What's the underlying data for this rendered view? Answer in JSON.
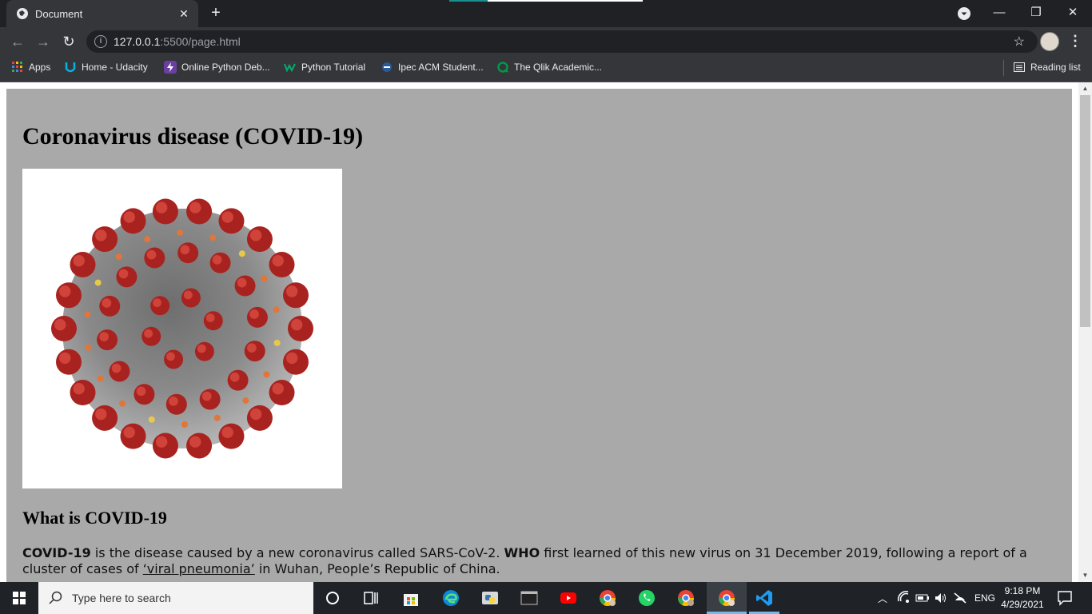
{
  "browser": {
    "tab_title": "Document",
    "url_host": "127.0.0.1",
    "url_rest": ":5500/page.html",
    "bookmarks": [
      {
        "label": "Apps",
        "icon": "apps-grid-icon"
      },
      {
        "label": "Home - Udacity",
        "icon": "udacity-icon"
      },
      {
        "label": "Online Python Deb...",
        "icon": "lightning-icon"
      },
      {
        "label": "Python Tutorial",
        "icon": "w3-icon"
      },
      {
        "label": "Ipec ACM Student...",
        "icon": "acm-icon"
      },
      {
        "label": "The Qlik Academic...",
        "icon": "qlik-icon"
      }
    ],
    "reading_list": "Reading list"
  },
  "page": {
    "title": "Coronavirus disease (COVID-19)",
    "section_heading": "What is COVID-19",
    "para_bold1": "COVID-19",
    "para_text1": " is the disease caused by a new coronavirus called SARS-CoV-2. ",
    "para_bold2": "WHO",
    "para_text2": " first learned of this new virus on 31 December 2019, following a report of a cluster of cases of ",
    "para_link": "‘viral pneumonia’",
    "para_text3": " in Wuhan, People’s Republic of China."
  },
  "taskbar": {
    "search_placeholder": "Type here to search",
    "language": "ENG",
    "time": "9:18 PM",
    "date": "4/29/2021"
  },
  "colors": {
    "page_bg": "#a9a9a9",
    "chrome_dark": "#202124",
    "chrome_toolbar": "#35363a"
  }
}
